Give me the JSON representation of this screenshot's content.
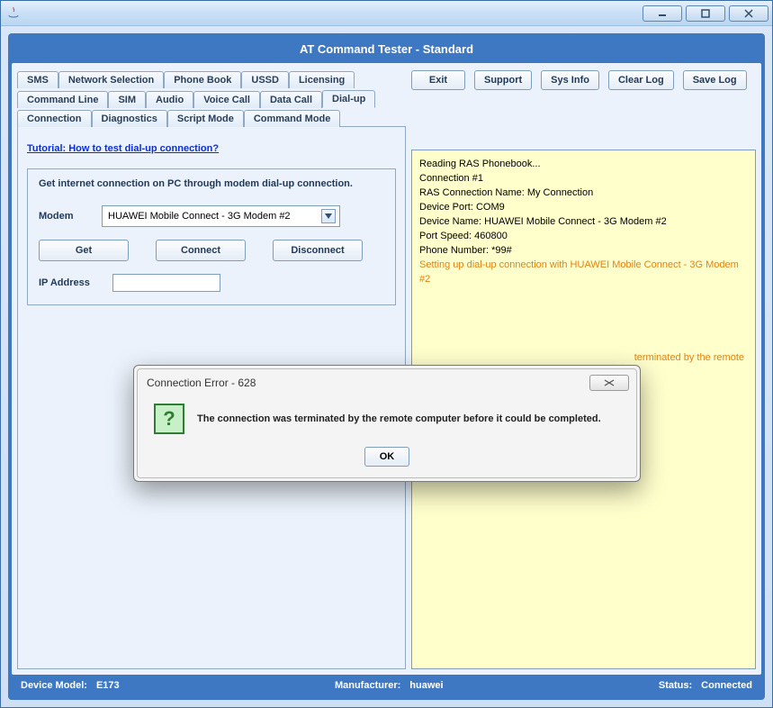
{
  "window": {
    "title": ""
  },
  "app": {
    "title": "AT Command Tester - Standard"
  },
  "actions": {
    "exit": "Exit",
    "support": "Support",
    "sysinfo": "Sys Info",
    "clearlog": "Clear Log",
    "savelog": "Save Log"
  },
  "tabs": {
    "row1": [
      "SMS",
      "Network Selection",
      "Phone Book",
      "USSD",
      "Licensing"
    ],
    "row2": [
      "Command Line",
      "SIM",
      "Audio",
      "Voice Call",
      "Data Call",
      "Dial-up"
    ],
    "row3": [
      "Connection",
      "Diagnostics",
      "Script Mode",
      "Command Mode"
    ],
    "active": "Dial-up"
  },
  "tutorial": {
    "text": "Tutorial: How to test dial-up connection?"
  },
  "dialup": {
    "group_title": "Get internet connection on PC through modem dial-up connection.",
    "modem_label": "Modem",
    "modem_value": "HUAWEI Mobile Connect - 3G Modem #2",
    "get": "Get",
    "connect": "Connect",
    "disconnect": "Disconnect",
    "ip_label": "IP Address",
    "ip_value": ""
  },
  "log": {
    "l1": "Reading RAS Phonebook...",
    "l2": "",
    "l3": "Connection #1",
    "l4": "RAS Connection Name: My Connection",
    "l5": "Device Port: COM9",
    "l6": "Device Name: HUAWEI Mobile Connect - 3G Modem #2",
    "l7": "Port Speed: 460800",
    "l8": "Phone Number: *99#",
    "l9": "",
    "o1": "Setting up dial-up connection with HUAWEI Mobile Connect - 3G Modem #2",
    "o2_frag": "terminated by the remote"
  },
  "modal": {
    "title": "Connection Error - 628",
    "message": "The connection was terminated by the remote computer before it could be completed.",
    "ok": "OK"
  },
  "status": {
    "model_label": "Device Model:",
    "model_value": "E173",
    "mfr_label": "Manufacturer:",
    "mfr_value": "huawei",
    "status_label": "Status:",
    "status_value": "Connected"
  }
}
